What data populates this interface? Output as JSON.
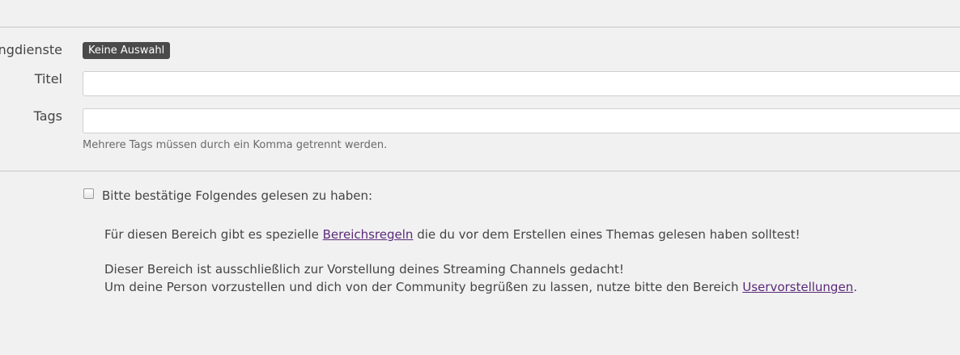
{
  "form": {
    "services_label": "ngdienste",
    "services_chip": "Keine Auswahl",
    "title_label": "Titel",
    "title_value": "",
    "tags_label": "Tags",
    "tags_value": "",
    "tags_hint": "Mehrere Tags müssen durch ein Komma getrennt werden."
  },
  "confirm": {
    "checkbox_checked": false,
    "label": "Bitte bestätige Folgendes gelesen zu haben:"
  },
  "rules": {
    "p1_before": "Für diesen Bereich gibt es spezielle ",
    "p1_link": "Bereichsregeln",
    "p1_after": " die du vor dem Erstellen eines Themas gelesen haben solltest!",
    "p2": "Dieser Bereich ist ausschließlich zur Vorstellung deines Streaming Channels gedacht!",
    "p3_before": "Um deine Person vorzustellen und dich von der Community begrüßen zu lassen, nutze bitte den Bereich ",
    "p3_link": "Uservorstellungen",
    "p3_after": "."
  }
}
